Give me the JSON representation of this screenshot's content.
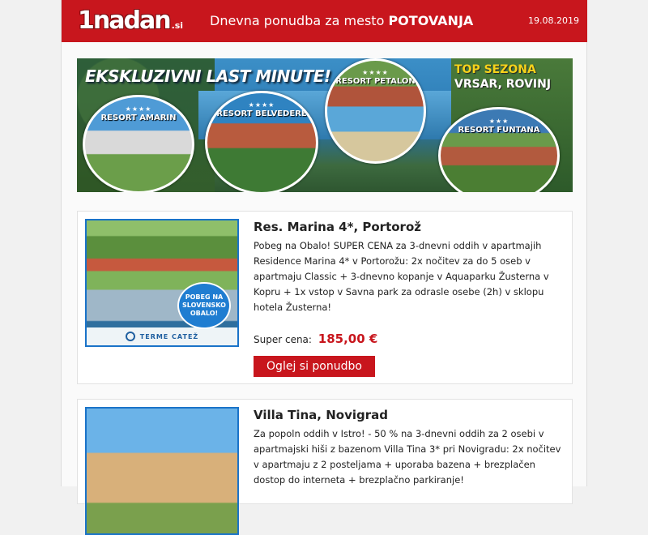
{
  "header": {
    "logo_text": "1nadan",
    "logo_suffix": ".si",
    "title_prefix": "Dnevna ponudba za mesto",
    "title_city": "POTOVANJA",
    "date": "19.08.2019"
  },
  "banner": {
    "headline": "EKSKLUZIVNI LAST MINUTE!",
    "top_sezona": "TOP SEZONA",
    "location": "VRSAR, ROVINJ",
    "resorts": [
      {
        "stars": "★★★★",
        "name": "RESORT AMARIN"
      },
      {
        "stars": "★★★★",
        "name": "RESORT BELVEDERE"
      },
      {
        "stars": "★★★★",
        "name": "RESORT PETALON"
      },
      {
        "stars": "★★★",
        "name": "RESORT FUNTANA"
      }
    ]
  },
  "offers": [
    {
      "title": "Res. Marina 4*, Portorož",
      "description": "Pobeg na Obalo! SUPER CENA za 3-dnevni oddih v apartmajih Residence Marina 4* v Portorožu: 2x nočitev za do 5 oseb v apartmaju Classic + 3-dnevno kopanje v Aquaparku Žusterna v Kopru + 1x vstop v Savna park za odrasle osebe (2h) v sklopu hotela Žusterna!",
      "price_label": "Super cena:",
      "price": "185,00 €",
      "cta": "Oglej si ponudbo",
      "badge": "POBEG NA SLOVENSKO OBALO!",
      "brand": "TERME CATEŽ"
    },
    {
      "title": "Villa Tina, Novigrad",
      "description": "Za popoln oddih v Istro! - 50 % na 3-dnevni oddih za 2 osebi v apartmajski hiši z bazenom Villa Tina 3* pri Novigradu: 2x nočitev v apartmaju z 2 posteljama + uporaba bazena + brezplačen dostop do interneta + brezplačno parkiranje!"
    }
  ],
  "colors": {
    "brand_red": "#c8161d",
    "accent_blue": "#1a73c8",
    "top_sezona_yellow": "#f6d21a"
  }
}
